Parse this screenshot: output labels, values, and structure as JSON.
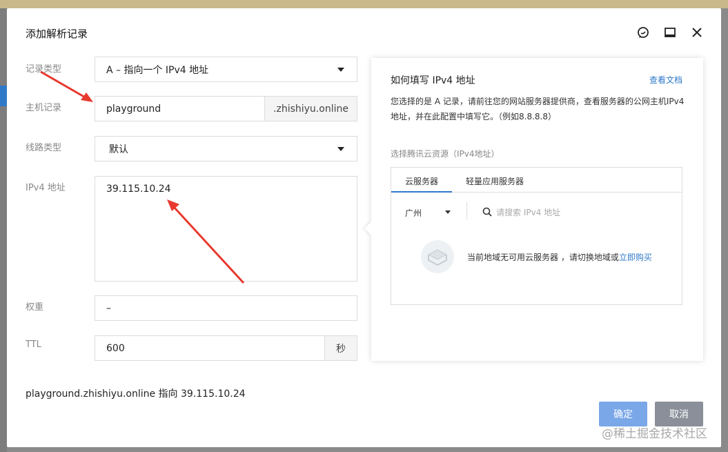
{
  "dialog": {
    "title": "添加解析记录"
  },
  "form": {
    "record_type": {
      "label": "记录类型",
      "value": "A – 指向一个 IPv4 地址"
    },
    "host": {
      "label": "主机记录",
      "value": "playground",
      "suffix": ".zhishiyu.online"
    },
    "line": {
      "label": "线路类型",
      "value": "默认"
    },
    "ipv4": {
      "label": "IPv4 地址",
      "value": "39.115.10.24"
    },
    "weight": {
      "label": "权重",
      "value": "–"
    },
    "ttl": {
      "label": "TTL",
      "value": "600",
      "unit": "秒"
    }
  },
  "summary": "playground.zhishiyu.online  指向  39.115.10.24",
  "buttons": {
    "ok": "确定",
    "cancel": "取消"
  },
  "help": {
    "title": "如何填写 IPv4 地址",
    "link": "查看文档",
    "desc": "您选择的是 A 记录，请前往您的网站服务器提供商，查看服务器的公网主机IPv4 地址，并在此配置中填写它。（例如8.8.8.8）",
    "resource_label": "选择腾讯云资源（IPv4地址）",
    "tabs": [
      "云服务器",
      "轻量应用服务器"
    ],
    "region": "广州",
    "search_placeholder": "请搜索 IPv4 地址",
    "empty_text": "当前地域无可用云服务器 ，请切换地域或",
    "empty_link": "立即购买"
  },
  "watermark": "@稀土掘金技术社区",
  "colors": {
    "accent": "#2f79c9",
    "ok_button": "#7aa7e8",
    "cancel_button": "#8a8f99",
    "annotation_arrow": "#e8392e"
  }
}
